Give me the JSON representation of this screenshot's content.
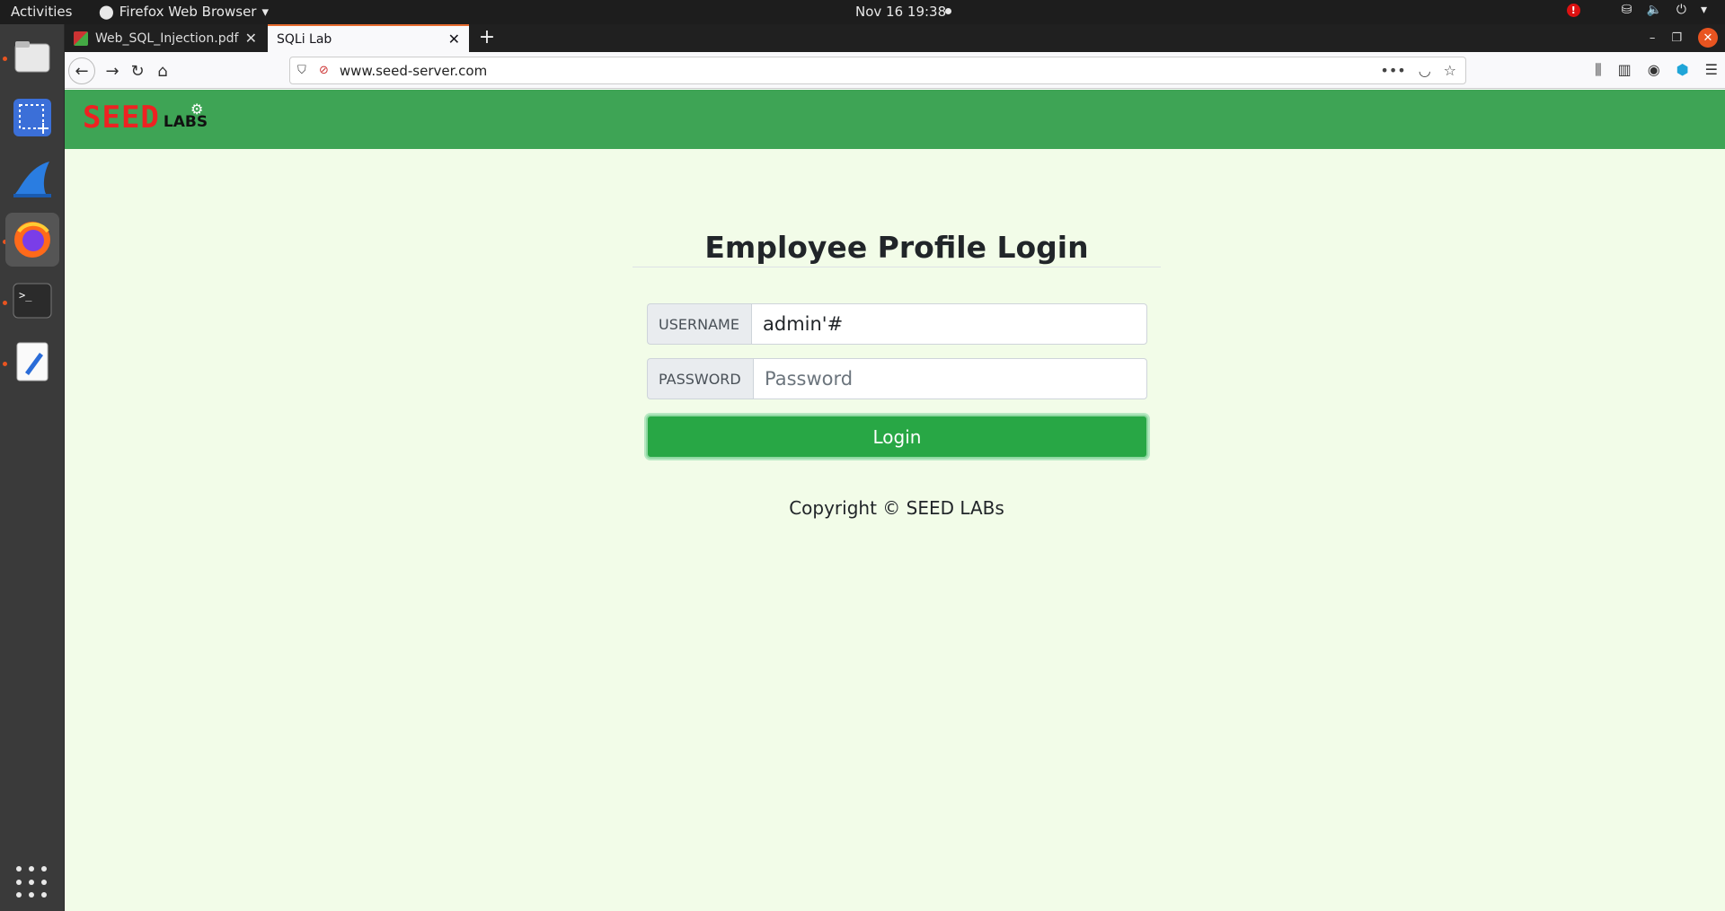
{
  "topbar": {
    "activities": "Activities",
    "app_name": "Firefox Web Browser",
    "clock": "Nov 16  19:38",
    "alert": "!"
  },
  "tabs": [
    {
      "label": "Web_SQL_Injection.pdf"
    },
    {
      "label": "SQLi Lab"
    }
  ],
  "urlbar": {
    "url": "www.seed-server.com"
  },
  "site": {
    "logo_seed": "SEED",
    "logo_labs": "LABS"
  },
  "login": {
    "title": "Employee Profile Login",
    "username_label": "USERNAME",
    "username_value": "admin'#",
    "password_label": "PASSWORD",
    "password_placeholder": "Password",
    "button": "Login",
    "copyright": "Copyright © SEED LABs"
  },
  "colors": {
    "header_green": "#3ea455",
    "button_green": "#28a745",
    "page_bg": "#f2fce8"
  }
}
